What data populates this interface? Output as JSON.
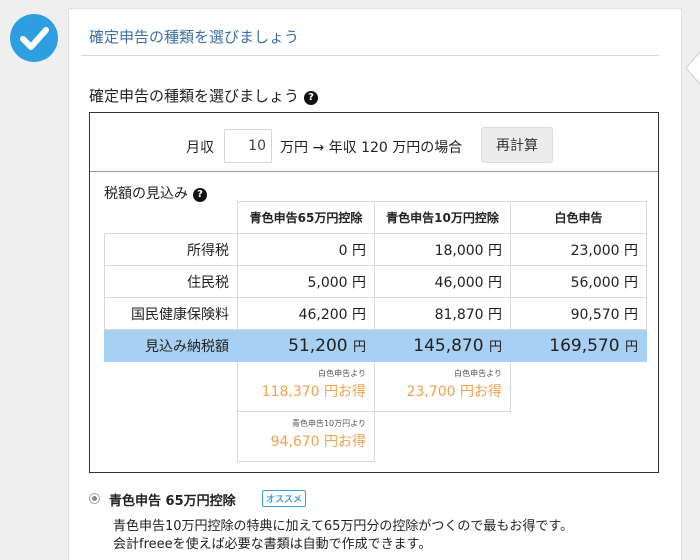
{
  "step": {
    "title": "確定申告の種類を選びましょう",
    "check_icon": "check-circle-icon"
  },
  "section": {
    "title": "確定申告の種類を選びましょう"
  },
  "calculator": {
    "monthly_label": "月収",
    "monthly_value": "10",
    "unit_arrow_label": "万円 → 年収 120 万円の場合",
    "recalc_label": "再計算"
  },
  "estimate": {
    "title": "税額の見込み",
    "columns": [
      "青色申告65万円控除",
      "青色申告10万円控除",
      "白色申告"
    ],
    "rows": [
      {
        "label": "所得税",
        "values": [
          "0 円",
          "18,000 円",
          "23,000 円"
        ]
      },
      {
        "label": "住民税",
        "values": [
          "5,000 円",
          "46,000 円",
          "56,000 円"
        ]
      },
      {
        "label": "国民健康保険料",
        "values": [
          "46,200 円",
          "81,870 円",
          "90,570 円"
        ]
      }
    ],
    "total": {
      "label": "見込み納税額",
      "values": [
        "51,200",
        "145,870",
        "169,570"
      ],
      "unit": "円"
    },
    "savings": [
      {
        "note": "白色申告より",
        "amount": "118,370 円お得"
      },
      {
        "note": "白色申告より",
        "amount": "23,700 円お得"
      },
      {
        "note": "青色申告10万円より",
        "amount": "94,670 円お得"
      }
    ]
  },
  "option": {
    "title": "青色申告 65万円控除",
    "badge": "オススメ",
    "desc1": "青色申告10万円控除の特典に加えて65万円分の控除がつくので最もお得です。",
    "desc2": "会計freeeを使えば必要な書類は自動で作成できます。"
  },
  "colors": {
    "accent": "#2d9fe0",
    "title_blue": "#3e6fa3",
    "highlight_row": "#a8d0f3",
    "savings_orange": "#f0a24a"
  }
}
